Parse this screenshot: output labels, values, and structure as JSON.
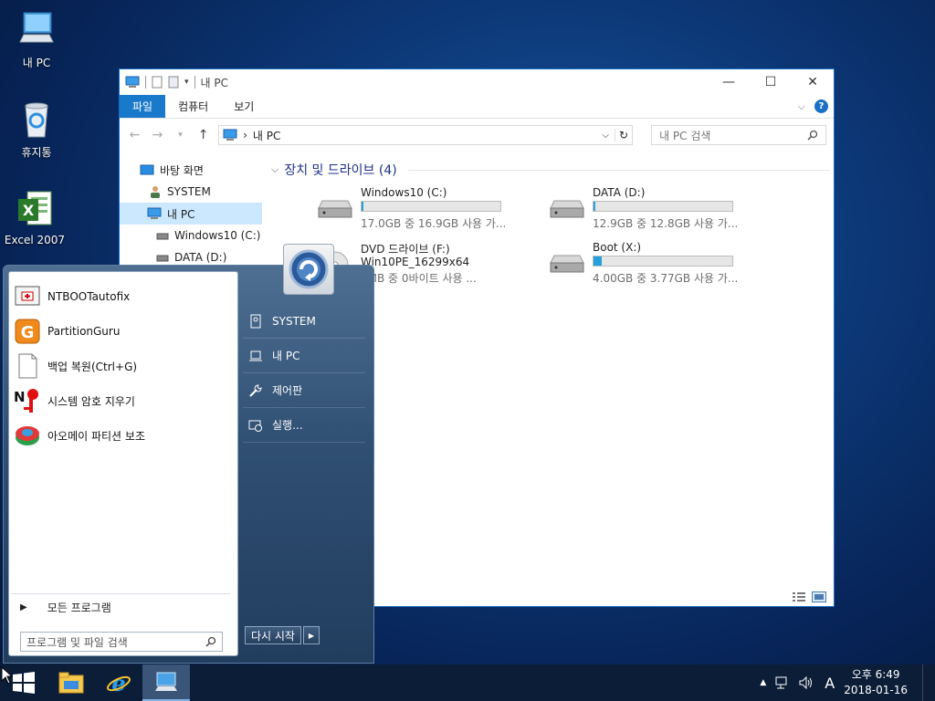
{
  "desktop": {
    "icons": [
      {
        "label": "내 PC",
        "icon": "computer-icon"
      },
      {
        "label": "휴지통",
        "icon": "recycle-bin-icon"
      },
      {
        "label": "Excel 2007",
        "icon": "excel-icon"
      }
    ]
  },
  "explorer": {
    "title": "내 PC",
    "tabs": [
      "파일",
      "컴퓨터",
      "보기"
    ],
    "address": {
      "path": "내 PC"
    },
    "search": {
      "placeholder": "내 PC 검색"
    },
    "nav_items": [
      "바탕 화면",
      "SYSTEM",
      "내 PC",
      "Windows10 (C:)",
      "DATA (D:)"
    ],
    "group_title": "장치 및 드라이브 (4)",
    "drives": [
      {
        "name": "Windows10 (C:)",
        "free_text": "17.0GB 중 16.9GB 사용 가...",
        "used_fraction": 0.01
      },
      {
        "name": "DATA (D:)",
        "free_text": "12.9GB 중 12.8GB 사용 가...",
        "used_fraction": 0.01
      },
      {
        "name": "DVD 드라이브 (F:)",
        "sub": "Win10PE_16299x64",
        "free_text": "0MB 중 0바이트 사용 ..."
      },
      {
        "name": "Boot (X:)",
        "free_text": "4.00GB 중 3.77GB 사용 가...",
        "used_fraction": 0.06
      }
    ]
  },
  "startmenu": {
    "programs": [
      "NTBOOTautofix",
      "PartitionGuru",
      "백업 복원(Ctrl+G)",
      "시스템 암호 지우기",
      "아오메이 파티션 보조"
    ],
    "all_programs": "모든 프로그램",
    "search_placeholder": "프로그램 및 파일 검색",
    "right_items": [
      "SYSTEM",
      "내 PC",
      "제어판",
      "실행..."
    ],
    "restart": "다시 시작"
  },
  "taskbar": {
    "tray": {
      "ime": "A",
      "time": "오후 6:49",
      "date": "2018-01-16"
    }
  },
  "colors": {
    "accent": "#1979ca",
    "drive_bar": "#26a0da",
    "taskbar": "#0c1d38"
  }
}
